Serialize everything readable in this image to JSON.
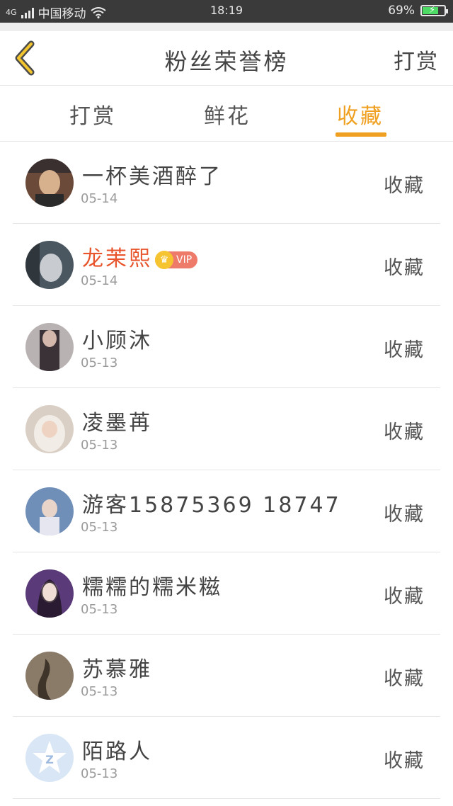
{
  "status_bar": {
    "carrier_signal": "4G",
    "carrier": "中国移动",
    "time": "18:19",
    "battery": "69%"
  },
  "header": {
    "title": "粉丝荣誉榜",
    "right_action": "打赏"
  },
  "tabs": [
    {
      "label": "打赏",
      "active": false
    },
    {
      "label": "鲜花",
      "active": false
    },
    {
      "label": "收藏",
      "active": true
    }
  ],
  "accent_color": "#f0a020",
  "vip_name_color": "#e8552d",
  "rows": [
    {
      "name": "一杯美酒醉了",
      "date": "05-14",
      "action": "收藏",
      "vip": false
    },
    {
      "name": "龙茉熙",
      "date": "05-14",
      "action": "收藏",
      "vip": true,
      "badge": "VIP"
    },
    {
      "name": "小顾沐",
      "date": "05-13",
      "action": "收藏",
      "vip": false
    },
    {
      "name": "凌墨苒",
      "date": "05-13",
      "action": "收藏",
      "vip": false
    },
    {
      "name": "游客15875369 18747",
      "date": "05-13",
      "action": "收藏",
      "vip": false
    },
    {
      "name": "糯糯的糯米糍",
      "date": "05-13",
      "action": "收藏",
      "vip": false
    },
    {
      "name": "苏慕雅",
      "date": "05-13",
      "action": "收藏",
      "vip": false
    },
    {
      "name": "陌路人",
      "date": "05-13",
      "action": "收藏",
      "vip": false
    }
  ]
}
